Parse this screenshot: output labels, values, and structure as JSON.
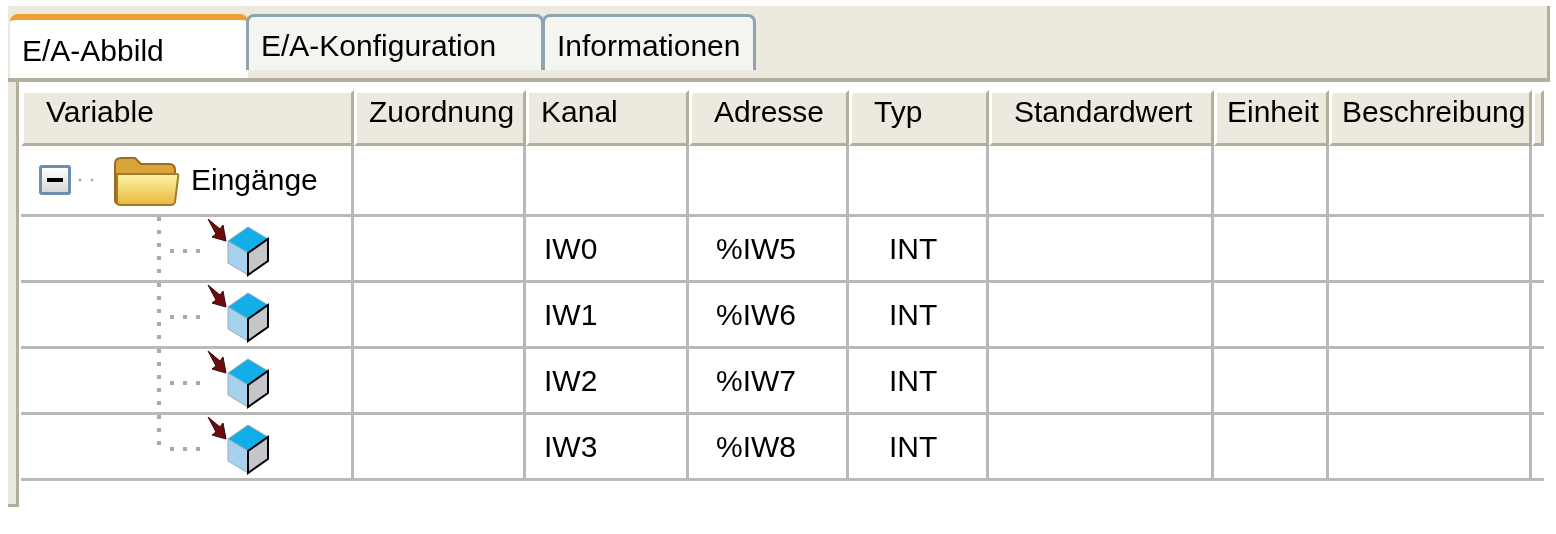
{
  "tabs": [
    {
      "label": "E/A-Abbild",
      "selected": true
    },
    {
      "label": "E/A-Konfiguration",
      "selected": false
    },
    {
      "label": "Informationen",
      "selected": false
    }
  ],
  "table": {
    "columns": [
      "Variable",
      "Zuordnung",
      "Kanal",
      "Adresse",
      "Typ",
      "Standardwert",
      "Einheit",
      "Beschreibung"
    ],
    "rows": [
      {
        "variable": "Eingänge",
        "expanded": true,
        "children": [
          {
            "channel": "IW0",
            "address": "%IW5",
            "type": "INT"
          },
          {
            "channel": "IW1",
            "address": "%IW6",
            "type": "INT"
          },
          {
            "channel": "IW2",
            "address": "%IW7",
            "type": "INT"
          },
          {
            "channel": "IW3",
            "address": "%IW8",
            "type": "INT"
          }
        ]
      }
    ]
  }
}
